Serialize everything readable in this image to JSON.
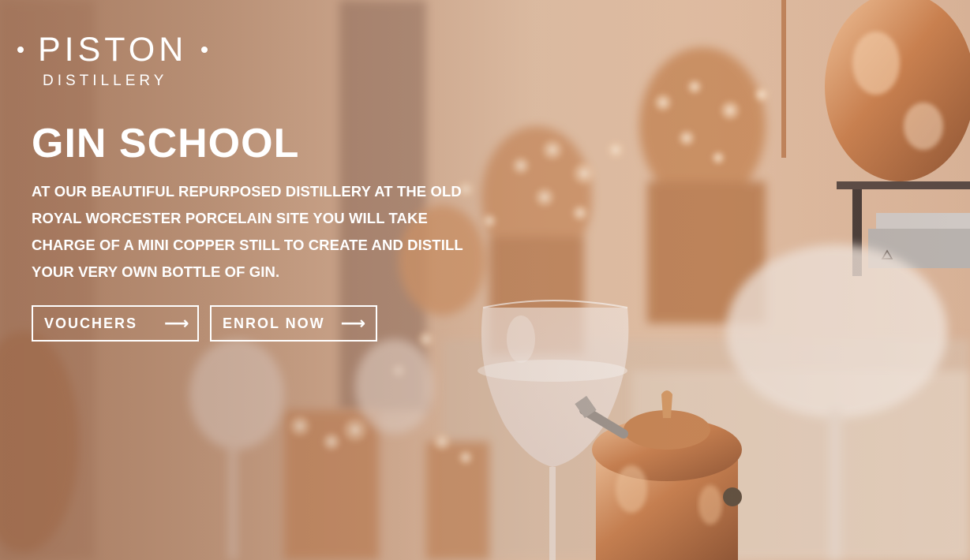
{
  "logo": {
    "name": "PISTON",
    "subtitle": "DISTILLERY"
  },
  "hero": {
    "title": "GIN SCHOOL",
    "description": "AT OUR BEAUTIFUL REPURPOSED DISTILLERY AT THE OLD ROYAL WORCESTER PORCELAIN SITE YOU WILL TAKE CHARGE OF A MINI COPPER STILL TO CREATE AND DISTILL YOUR VERY OWN BOTTLE OF GIN.",
    "buttons": [
      {
        "label": "VOUCHERS",
        "icon": "arrow-right-icon",
        "glyph": "⟶"
      },
      {
        "label": "ENROL NOW",
        "icon": "arrow-right-icon",
        "glyph": "⟶"
      }
    ]
  },
  "colors": {
    "text": "#ffffff",
    "copper": "#c98a5a",
    "background_warm": "#e2bfa4"
  }
}
